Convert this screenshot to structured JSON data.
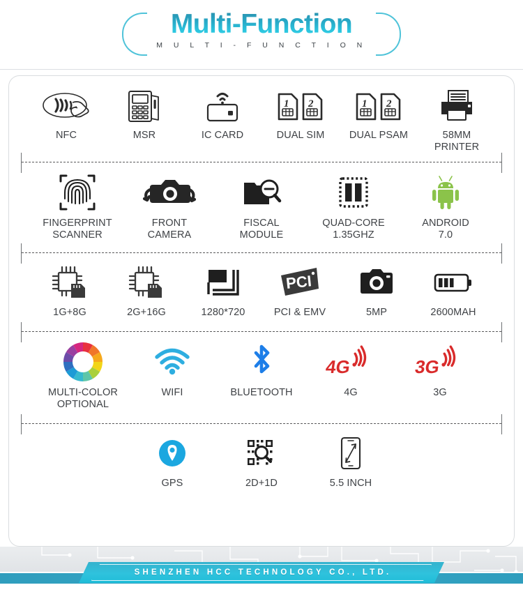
{
  "header": {
    "title": "Multi-Function",
    "subtitle": "M U L T I - F U N C T I O N",
    "title_gradient_top": "#2e8ba8",
    "title_gradient_bottom": "#46d6ea",
    "bracket_color": "#4fc3d9"
  },
  "rows": [
    {
      "id": "row-1",
      "items": [
        {
          "icon": "nfc-icon",
          "label": "NFC"
        },
        {
          "icon": "msr-icon",
          "label": "MSR"
        },
        {
          "icon": "ic-card-icon",
          "label": "IC CARD"
        },
        {
          "icon": "dual-sim-icon",
          "label": "DUAL SIM"
        },
        {
          "icon": "dual-psam-icon",
          "label": "DUAL PSAM"
        },
        {
          "icon": "printer-icon",
          "label": "58MM\nPRINTER"
        }
      ]
    },
    {
      "id": "row-2",
      "items": [
        {
          "icon": "fingerprint-icon",
          "label": "FINGERPRINT\nSCANNER"
        },
        {
          "icon": "front-camera-icon",
          "label": "FRONT\nCAMERA"
        },
        {
          "icon": "fiscal-module-icon",
          "label": "FISCAL\nMODULE"
        },
        {
          "icon": "cpu-icon",
          "label": "QUAD-CORE\n1.35GHZ"
        },
        {
          "icon": "android-icon",
          "label": "ANDROID\n7.0"
        }
      ]
    },
    {
      "id": "row-3",
      "items": [
        {
          "icon": "memory-chip-icon",
          "label": "1G+8G"
        },
        {
          "icon": "memory-chip-icon",
          "label": "2G+16G"
        },
        {
          "icon": "resolution-icon",
          "label": "1280*720"
        },
        {
          "icon": "pci-emv-icon",
          "label": "PCI & EMV"
        },
        {
          "icon": "camera-icon",
          "label": "5MP"
        },
        {
          "icon": "battery-icon",
          "label": "2600MAH"
        }
      ]
    },
    {
      "id": "row-4",
      "items": [
        {
          "icon": "color-wheel-icon",
          "label": "MULTI-COLOR\nOPTIONAL"
        },
        {
          "icon": "wifi-icon",
          "label": "WIFI"
        },
        {
          "icon": "bluetooth-icon",
          "label": "BLUETOOTH"
        },
        {
          "icon": "4g-icon",
          "label": "4G"
        },
        {
          "icon": "3g-icon",
          "label": "3G"
        }
      ]
    },
    {
      "id": "row-5",
      "items": [
        {
          "icon": "gps-icon",
          "label": "GPS"
        },
        {
          "icon": "qr-scanner-icon",
          "label": "2D+1D"
        },
        {
          "icon": "screen-size-icon",
          "label": "5.5 INCH"
        }
      ]
    }
  ],
  "icon_colors": {
    "dark": "#262626",
    "outline": "#2b2b2b",
    "android_green": "#8bc34a",
    "wifi_blue": "#2eaee0",
    "bluetooth_blue": "#1d7ee8",
    "cellular_red": "#d92b2b",
    "gps_blue": "#1ba7e0"
  },
  "footer": {
    "company": "SHENZHEN HCC TECHNOLOGY CO., LTD.",
    "banner_color": "#2fc2dd",
    "strip_color": "#2f9dbd"
  }
}
